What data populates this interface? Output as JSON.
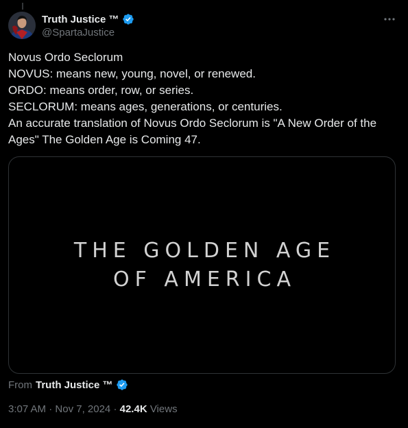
{
  "author": {
    "display_name": "Truth Justice ™",
    "handle": "@SpartaJustice",
    "verified": true,
    "avatar_icon": "superhero-avatar-icon"
  },
  "tweet": {
    "lines": [
      "Novus Ordo Seclorum",
      "NOVUS: means new, young, novel, or renewed.",
      "ORDO: means order, row, or series.",
      "SECLORUM: means ages, generations, or centuries.",
      "An accurate translation of Novus Ordo Seclorum is \"A New Order of the Ages\" The Golden Age is Coming 47."
    ]
  },
  "media": {
    "line1": "THE GOLDEN AGE",
    "line2": "OF AMERICA"
  },
  "footer": {
    "from_label": "From",
    "from_name": "Truth Justice ™",
    "time": "3:07 AM",
    "separator": " · ",
    "date": "Nov 7, 2024",
    "views_count": "42.4K",
    "views_label": "Views"
  },
  "colors": {
    "background": "#000000",
    "text_primary": "#e7e9ea",
    "text_secondary": "#71767b",
    "verified_blue": "#1d9bf0",
    "border": "#2f3336"
  },
  "icons": {
    "more": "more-horizontal-icon",
    "verified": "verified-badge-icon"
  }
}
